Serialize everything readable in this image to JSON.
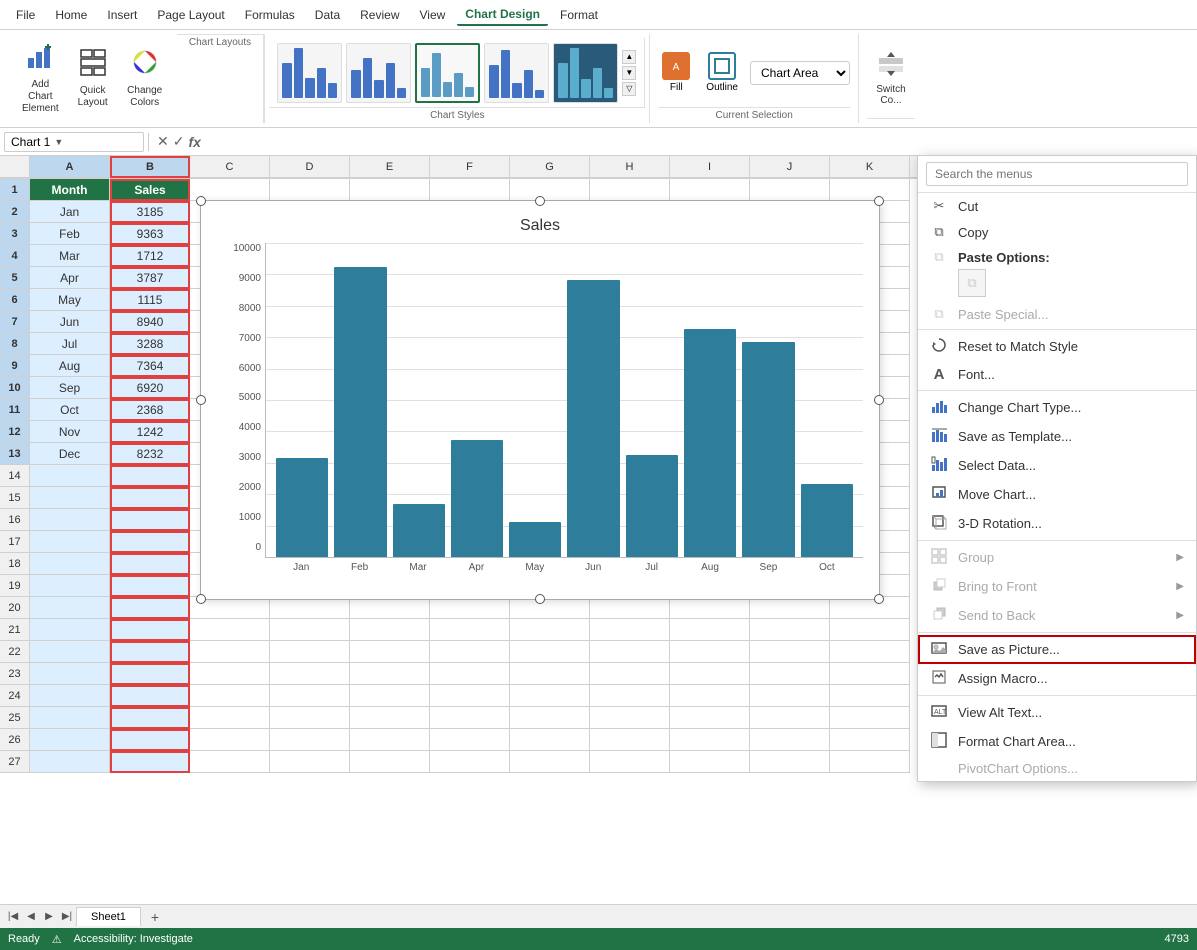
{
  "menubar": {
    "items": [
      "File",
      "Home",
      "Insert",
      "Page Layout",
      "Formulas",
      "Data",
      "Review",
      "View",
      "Chart Design",
      "Format"
    ]
  },
  "ribbon": {
    "chart_layouts_label": "Chart Layouts",
    "chart_styles_label": "Chart Styles",
    "add_chart_element_label": "Add Chart\nElement",
    "quick_layout_label": "Quick\nLayout",
    "change_colors_label": "Change\nColors",
    "fill_label": "Fill",
    "outline_label": "Outline",
    "chart_area_value": "Chart Area",
    "switch_col_label": "Switch\nCo..."
  },
  "formula_bar": {
    "name_box": "Chart 1",
    "fx_label": "fx"
  },
  "spreadsheet": {
    "columns": [
      "A",
      "B",
      "C",
      "D",
      "E",
      "F",
      "G",
      "H",
      "I",
      "J",
      "K"
    ],
    "rows": [
      {
        "num": 1,
        "a": "Month",
        "b": "Sales"
      },
      {
        "num": 2,
        "a": "Jan",
        "b": "3185"
      },
      {
        "num": 3,
        "a": "Feb",
        "b": "9363"
      },
      {
        "num": 4,
        "a": "Mar",
        "b": "1712"
      },
      {
        "num": 5,
        "a": "Apr",
        "b": "3787"
      },
      {
        "num": 6,
        "a": "May",
        "b": "1115"
      },
      {
        "num": 7,
        "a": "Jun",
        "b": "8940"
      },
      {
        "num": 8,
        "a": "Jul",
        "b": "3288"
      },
      {
        "num": 9,
        "a": "Aug",
        "b": "7364"
      },
      {
        "num": 10,
        "a": "Sep",
        "b": "6920"
      },
      {
        "num": 11,
        "a": "Oct",
        "b": "2368"
      },
      {
        "num": 12,
        "a": "Nov",
        "b": "1242"
      },
      {
        "num": 13,
        "a": "Dec",
        "b": "8232"
      },
      {
        "num": 14,
        "a": "",
        "b": ""
      },
      {
        "num": 15,
        "a": "",
        "b": ""
      },
      {
        "num": 16,
        "a": "",
        "b": ""
      },
      {
        "num": 17,
        "a": "",
        "b": ""
      },
      {
        "num": 18,
        "a": "",
        "b": ""
      },
      {
        "num": 19,
        "a": "",
        "b": ""
      },
      {
        "num": 20,
        "a": "",
        "b": ""
      },
      {
        "num": 21,
        "a": "",
        "b": ""
      },
      {
        "num": 22,
        "a": "",
        "b": ""
      },
      {
        "num": 23,
        "a": "",
        "b": ""
      },
      {
        "num": 24,
        "a": "",
        "b": ""
      },
      {
        "num": 25,
        "a": "",
        "b": ""
      },
      {
        "num": 26,
        "a": "",
        "b": ""
      },
      {
        "num": 27,
        "a": "",
        "b": ""
      }
    ]
  },
  "chart": {
    "title": "Sales",
    "y_labels": [
      "10000",
      "9000",
      "8000",
      "7000",
      "6000",
      "5000",
      "4000",
      "3000",
      "2000",
      "1000",
      "0"
    ],
    "bars": [
      {
        "label": "Jan",
        "value": 3185,
        "height_pct": 31.85
      },
      {
        "label": "Feb",
        "value": 9363,
        "height_pct": 93.63
      },
      {
        "label": "Mar",
        "value": 1712,
        "height_pct": 17.12
      },
      {
        "label": "Apr",
        "value": 3787,
        "height_pct": 37.87
      },
      {
        "label": "May",
        "value": 1115,
        "height_pct": 11.15
      },
      {
        "label": "Jun",
        "value": 8940,
        "height_pct": 89.4
      },
      {
        "label": "Jul",
        "value": 3288,
        "height_pct": 32.88
      },
      {
        "label": "Aug",
        "value": 7364,
        "height_pct": 73.64
      },
      {
        "label": "Sep",
        "value": 6920,
        "height_pct": 69.2
      },
      {
        "label": "Oct",
        "value": 2368,
        "height_pct": 23.68
      }
    ]
  },
  "context_menu": {
    "search_placeholder": "Search the menus",
    "items": [
      {
        "id": "cut",
        "icon": "✂",
        "label": "Cut",
        "disabled": false
      },
      {
        "id": "copy",
        "icon": "⧉",
        "label": "Copy",
        "disabled": false
      },
      {
        "id": "paste_options",
        "label": "Paste Options:",
        "type": "paste_header"
      },
      {
        "id": "paste_special",
        "icon": "⧉",
        "label": "Paste Special...",
        "disabled": true
      },
      {
        "id": "reset",
        "icon": "↺",
        "label": "Reset to Match Style",
        "disabled": false
      },
      {
        "id": "font",
        "icon": "A",
        "label": "Font...",
        "disabled": false
      },
      {
        "id": "change_chart_type",
        "icon": "📊",
        "label": "Change Chart Type...",
        "disabled": false
      },
      {
        "id": "save_as_template",
        "icon": "📊",
        "label": "Save as Template...",
        "disabled": false
      },
      {
        "id": "select_data",
        "icon": "📊",
        "label": "Select Data...",
        "disabled": false
      },
      {
        "id": "move_chart",
        "icon": "📊",
        "label": "Move Chart...",
        "disabled": false
      },
      {
        "id": "rotation",
        "icon": "🔲",
        "label": "3-D Rotation...",
        "disabled": false
      },
      {
        "id": "group",
        "label": "Group",
        "disabled": true,
        "has_arrow": true
      },
      {
        "id": "bring_to_front",
        "label": "Bring to Front",
        "disabled": true,
        "has_arrow": true
      },
      {
        "id": "send_to_back",
        "label": "Send to Back",
        "disabled": true,
        "has_arrow": true
      },
      {
        "id": "save_as_picture",
        "label": "Save as Picture...",
        "disabled": false,
        "highlighted": true
      },
      {
        "id": "assign_macro",
        "label": "Assign Macro...",
        "disabled": false
      },
      {
        "id": "view_alt_text",
        "icon": "🔲",
        "label": "View Alt Text...",
        "disabled": false
      },
      {
        "id": "format_chart_area",
        "icon": "🔲",
        "label": "Format Chart Area...",
        "disabled": false
      },
      {
        "id": "pivot_chart",
        "label": "PivotChart Options...",
        "disabled": true
      }
    ]
  },
  "tabs": {
    "sheet_name": "Sheet1",
    "add_label": "+"
  },
  "status_bar": {
    "ready": "Ready",
    "accessibility": "Accessibility: Investigate",
    "zoom_value": "4793"
  }
}
